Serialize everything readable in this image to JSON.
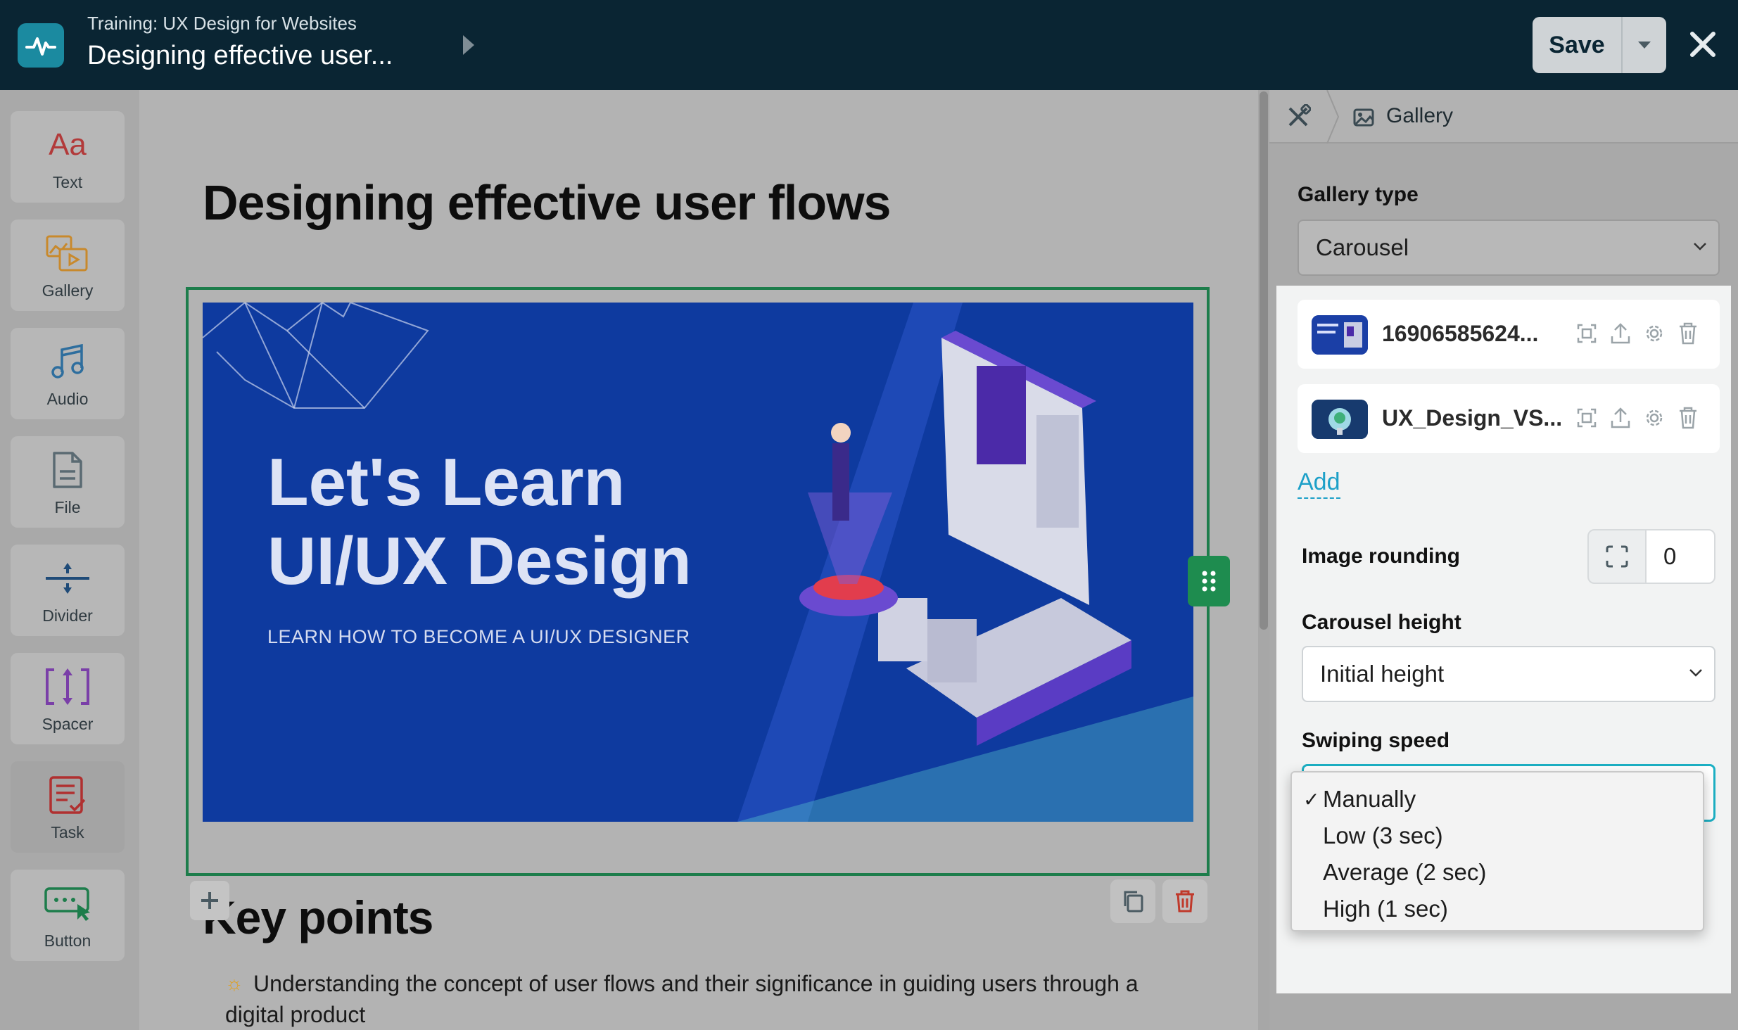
{
  "header": {
    "subtitle": "Training: UX Design for Websites",
    "title": "Designing effective user...",
    "save_label": "Save"
  },
  "toolbox": {
    "items": [
      {
        "label": "Text",
        "icon": "text-aa-icon"
      },
      {
        "label": "Gallery",
        "icon": "gallery-icon"
      },
      {
        "label": "Audio",
        "icon": "music-note-icon"
      },
      {
        "label": "File",
        "icon": "file-icon"
      },
      {
        "label": "Divider",
        "icon": "divider-icon"
      },
      {
        "label": "Spacer",
        "icon": "spacer-icon"
      },
      {
        "label": "Task",
        "icon": "task-icon"
      },
      {
        "label": "Button",
        "icon": "button-icon"
      }
    ],
    "text_glyph": "Aa"
  },
  "canvas": {
    "page_title": "Designing effective user flows",
    "banner": {
      "headline_line1": "Let's Learn",
      "headline_line2": "UI/UX Design",
      "subline": "LEARN HOW TO BECOME A UI/UX DESIGNER"
    },
    "key_points_title": "Key points",
    "key_points": [
      "Understanding the concept of user flows and their significance in guiding users through a digital product"
    ]
  },
  "panel": {
    "breadcrumb_label": "Gallery",
    "gallery_type_label": "Gallery type",
    "gallery_type_value": "Carousel",
    "files": [
      {
        "name": "16906585624..."
      },
      {
        "name": "UX_Design_VS..."
      }
    ],
    "add_label": "Add",
    "image_rounding_label": "Image rounding",
    "image_rounding_value": "0",
    "carousel_height_label": "Carousel height",
    "carousel_height_value": "Initial height",
    "swiping_speed_label": "Swiping speed",
    "swiping_speed_options": [
      {
        "label": "Manually",
        "checked": true
      },
      {
        "label": "Low (3 sec)",
        "checked": false
      },
      {
        "label": "Average (2 sec)",
        "checked": false
      },
      {
        "label": "High (1 sec)",
        "checked": false
      }
    ],
    "check_glyph": "✓"
  },
  "colors": {
    "topbar": "#0a2533",
    "accent_green": "#1d7d4b",
    "accent_teal": "#1da0c8",
    "delete_red": "#c0392b"
  }
}
